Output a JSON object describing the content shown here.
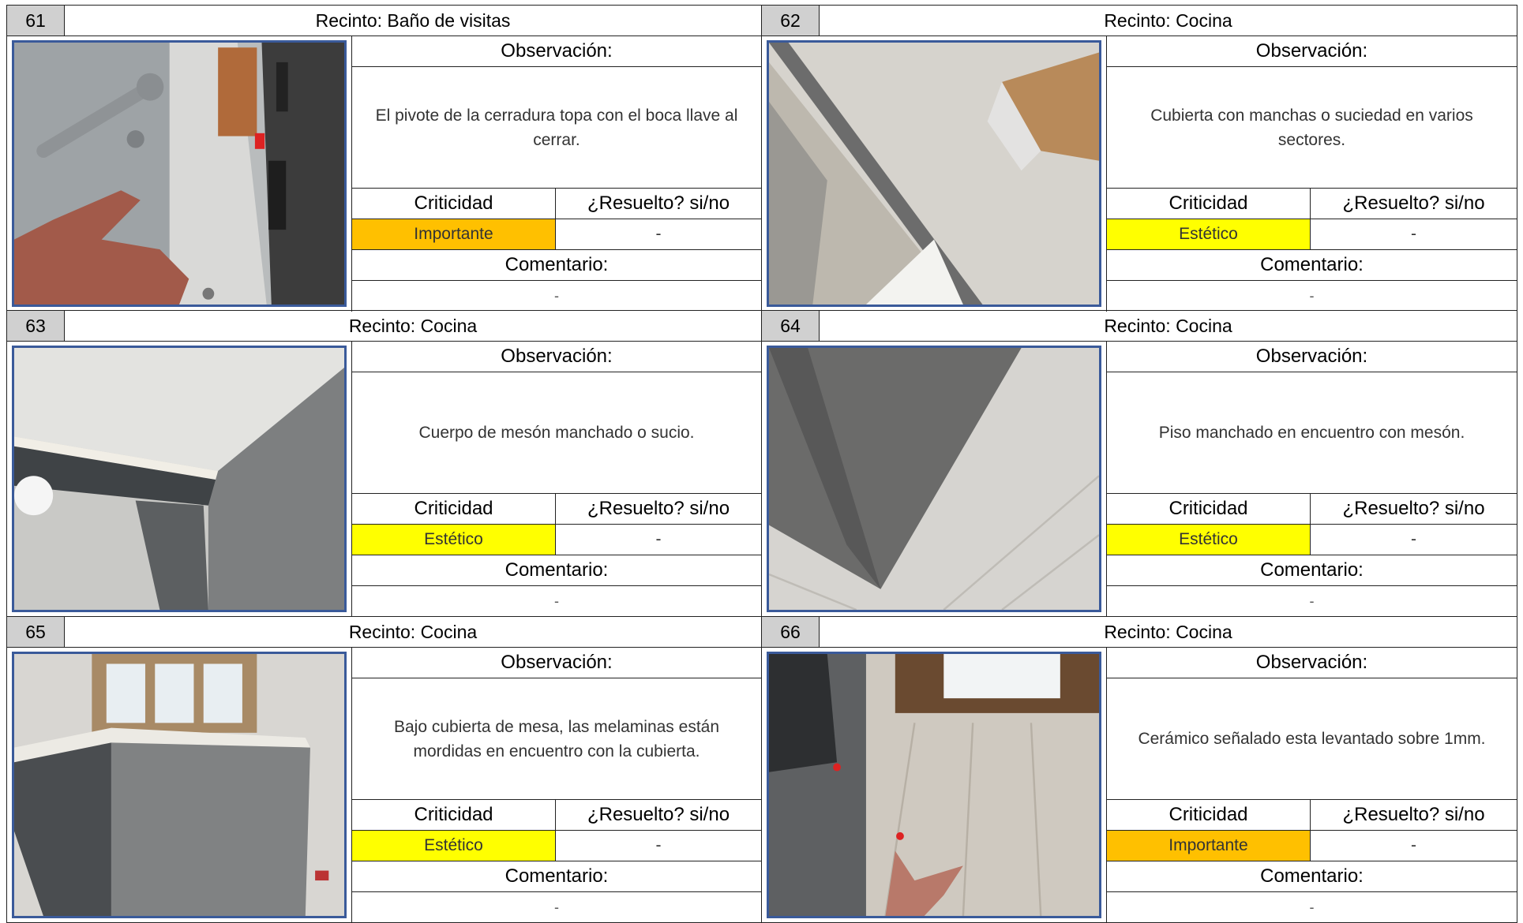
{
  "cards": [
    {
      "num": "61",
      "recinto": "Recinto: Baño de visitas",
      "obs_label": "Observación:",
      "obs": "El pivote de la cerradura topa con el boca llave al cerrar.",
      "crit_label": "Criticidad",
      "res_label": "¿Resuelto? si/no",
      "crit": "Importante",
      "crit_level": "importante",
      "res": "-",
      "com_label": "Comentario:",
      "com": "-"
    },
    {
      "num": "62",
      "recinto": "Recinto: Cocina",
      "obs_label": "Observación:",
      "obs": "Cubierta con manchas o suciedad en varios sectores.",
      "crit_label": "Criticidad",
      "res_label": "¿Resuelto? si/no",
      "crit": "Estético",
      "crit_level": "estetico",
      "res": "-",
      "com_label": "Comentario:",
      "com": "-"
    },
    {
      "num": "63",
      "recinto": "Recinto: Cocina",
      "obs_label": "Observación:",
      "obs": "Cuerpo de mesón manchado o sucio.",
      "crit_label": "Criticidad",
      "res_label": "¿Resuelto? si/no",
      "crit": "Estético",
      "crit_level": "estetico",
      "res": "-",
      "com_label": "Comentario:",
      "com": "-"
    },
    {
      "num": "64",
      "recinto": "Recinto: Cocina",
      "obs_label": "Observación:",
      "obs": "Piso manchado en encuentro con mesón.",
      "crit_label": "Criticidad",
      "res_label": "¿Resuelto? si/no",
      "crit": "Estético",
      "crit_level": "estetico",
      "res": "-",
      "com_label": "Comentario:",
      "com": "-"
    },
    {
      "num": "65",
      "recinto": "Recinto: Cocina",
      "obs_label": "Observación:",
      "obs": "Bajo cubierta de mesa, las melaminas están mordidas en encuentro con la cubierta.",
      "crit_label": "Criticidad",
      "res_label": "¿Resuelto? si/no",
      "crit": "Estético",
      "crit_level": "estetico",
      "res": "-",
      "com_label": "Comentario:",
      "com": "-"
    },
    {
      "num": "66",
      "recinto": "Recinto: Cocina",
      "obs_label": "Observación:",
      "obs": "Cerámico señalado esta levantado sobre 1mm.",
      "crit_label": "Criticidad",
      "res_label": "¿Resuelto? si/no",
      "crit": "Importante",
      "crit_level": "importante",
      "res": "-",
      "com_label": "Comentario:",
      "com": "-"
    }
  ],
  "colors": {
    "importante": "#ffc000",
    "estetico": "#ffff00",
    "photo_border": "#3a5a9a",
    "num_bg": "#d0d0d0"
  }
}
